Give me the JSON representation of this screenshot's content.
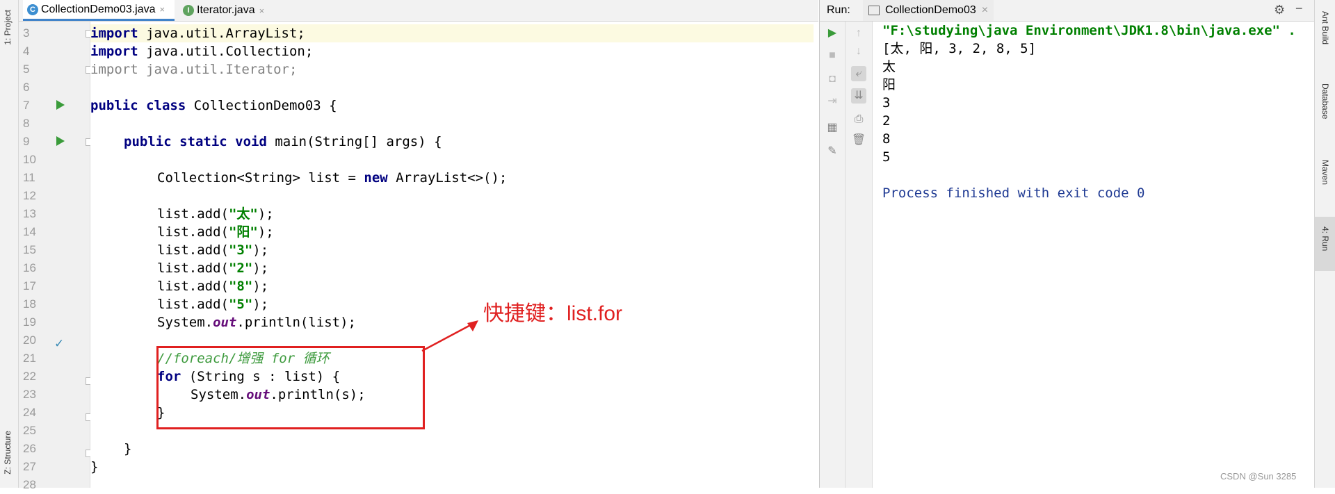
{
  "tool_windows": {
    "left": [
      {
        "label": "1: Project",
        "icon": "folder-icon"
      },
      {
        "label": "Z: Structure",
        "icon": "structure-icon"
      }
    ],
    "right": [
      {
        "label": "Ant Build",
        "icon": "ant-icon"
      },
      {
        "label": "Database",
        "icon": "database-icon"
      },
      {
        "label": "Maven",
        "icon": "maven-icon"
      },
      {
        "label": "4: Run",
        "icon": "run-icon"
      }
    ]
  },
  "editor": {
    "tabs": [
      {
        "label": "CollectionDemo03.java",
        "icon_letter": "C",
        "icon_color": "#3d8fd1",
        "active": true,
        "close": "×"
      },
      {
        "label": "Iterator.java",
        "icon_letter": "I",
        "icon_color": "#5fa35f",
        "active": false,
        "close": "×"
      }
    ],
    "line_numbers": [
      "3",
      "4",
      "5",
      "6",
      "7",
      "8",
      "9",
      "10",
      "11",
      "12",
      "13",
      "14",
      "15",
      "16",
      "17",
      "18",
      "19",
      "20",
      "21",
      "22",
      "23",
      "24",
      "25",
      "26",
      "27",
      "28"
    ],
    "code": {
      "l3_kw": "import",
      "l3_rest": " java.util.ArrayList;",
      "l4_kw": "import",
      "l4_rest": " java.util.Collection;",
      "l5": "import java.util.Iterator;",
      "l7_kw": "public class",
      "l7_rest": " CollectionDemo03 {",
      "l9_kw": "public static void",
      "l9_rest": " main(String[] args) {",
      "l11_a": "Collection<String> list = ",
      "l11_kw": "new",
      "l11_b": " ArrayList<>();",
      "adds": [
        {
          "pre": "list.add(",
          "arg": "\"太\"",
          "post": ");"
        },
        {
          "pre": "list.add(",
          "arg": "\"阳\"",
          "post": ");"
        },
        {
          "pre": "list.add(",
          "arg": "\"3\"",
          "post": ");"
        },
        {
          "pre": "list.add(",
          "arg": "\"2\"",
          "post": ");"
        },
        {
          "pre": "list.add(",
          "arg": "\"8\"",
          "post": ");"
        },
        {
          "pre": "list.add(",
          "arg": "\"5\"",
          "post": ");"
        }
      ],
      "l19_a": "System.",
      "l19_out": "out",
      "l19_b": ".println(list);",
      "l21_comment": "//foreach/增强 for 循环",
      "l22_kw": "for",
      "l22_rest": " (String s : list) {",
      "l23_a": "System.",
      "l23_out": "out",
      "l23_b": ".println(s);",
      "l24": "}",
      "l26": "}",
      "l27": "}"
    },
    "annotation": "快捷键：list.for",
    "accent_color": "#e02020"
  },
  "run_panel": {
    "label": "Run:",
    "tab_label": "CollectionDemo03",
    "tab_close": "×",
    "console": [
      "\"F:\\studying\\java Environment\\JDK1.8\\bin\\java.exe\" .",
      "[太, 阳, 3, 2, 8, 5]",
      "太",
      "阳",
      "3",
      "2",
      "8",
      "5",
      "",
      "Process finished with exit code 0"
    ]
  },
  "watermark": "CSDN @Sun 3285"
}
